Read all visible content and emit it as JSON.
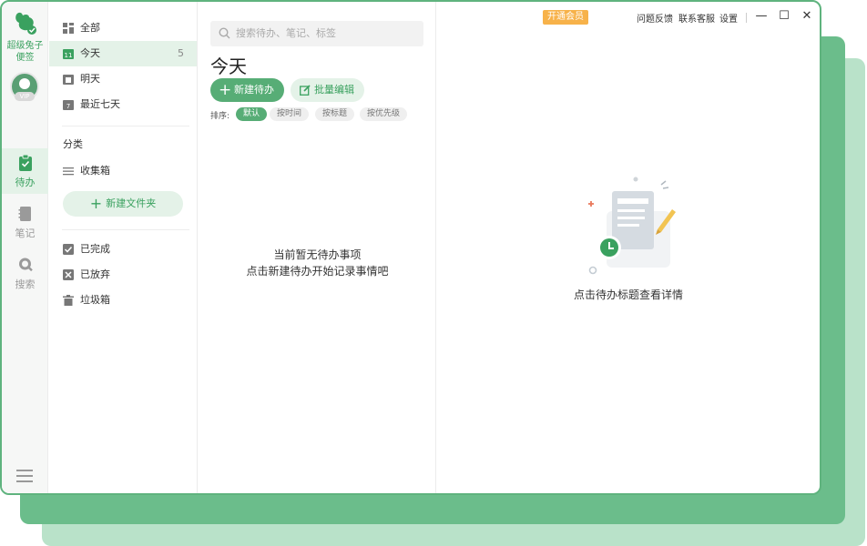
{
  "brand": {
    "line1": "超级兔子",
    "line2": "便签",
    "vip": "VIP"
  },
  "rail": {
    "items": [
      {
        "label": "待办",
        "icon": "clipboard-icon",
        "active": true
      },
      {
        "label": "笔记",
        "icon": "notebook-icon",
        "active": false
      },
      {
        "label": "搜索",
        "icon": "search-icon",
        "active": false
      }
    ]
  },
  "nav": {
    "items": [
      {
        "label": "全部",
        "icon": "grid-icon"
      },
      {
        "label": "今天",
        "icon": "calendar-today-icon",
        "count": "5"
      },
      {
        "label": "明天",
        "icon": "calendar-tomorrow-icon"
      },
      {
        "label": "最近七天",
        "icon": "calendar-week-icon"
      }
    ],
    "category_title": "分类",
    "inbox": "收集箱",
    "new_folder": "新建文件夹",
    "done": "已完成",
    "abandoned": "已放弃",
    "trash": "垃圾箱"
  },
  "list": {
    "search_placeholder": "搜索待办、笔记、标签",
    "title": "今天",
    "new_button": "新建待办",
    "batch_button": "批量编辑",
    "sort_label": "排序:",
    "sort_options": [
      "默认",
      "按时间",
      "按标题",
      "按优先级"
    ],
    "empty_line1": "当前暂无待办事项",
    "empty_line2": "点击新建待办开始记录事情吧"
  },
  "detail": {
    "empty_text": "点击待办标题查看详情"
  },
  "titlebar": {
    "member": "开通会员",
    "feedback": "问题反馈",
    "support": "联系客服",
    "settings": "设置",
    "minimize": "—",
    "maximize": "☐",
    "close": "✕"
  },
  "colors": {
    "accent": "#57ad76",
    "accent_light": "#e4f2e8",
    "member": "#f7b24a"
  }
}
